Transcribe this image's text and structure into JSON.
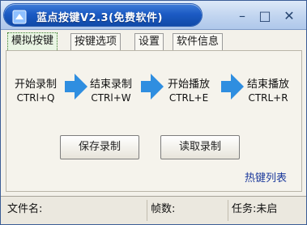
{
  "window": {
    "title": "蓝点按键V2.3(免费软件)",
    "minimize_glyph": "–",
    "maximize_glyph": "□",
    "close_glyph": "✕",
    "title_color": "#1c5bc4"
  },
  "tabs": [
    {
      "label": "模拟按键",
      "active": true
    },
    {
      "label": "按键选项",
      "active": false
    },
    {
      "label": "设置",
      "active": false
    },
    {
      "label": "软件信息",
      "active": false
    }
  ],
  "steps": [
    {
      "label": "开始录制",
      "hotkey": "CTRl+Q"
    },
    {
      "label": "结束录制",
      "hotkey": "CTRl+W"
    },
    {
      "label": "开始播放",
      "hotkey": "CTRL+E"
    },
    {
      "label": "结束播放",
      "hotkey": "CTRL+R"
    }
  ],
  "arrow_icon": "right-arrow-icon",
  "arrow_color": "#2f8ee0",
  "buttons": {
    "save": "保存录制",
    "load": "读取录制"
  },
  "hotkey_list_link": "热键列表",
  "status": {
    "filename": "文件名:",
    "frames": "帧数:",
    "task": "任务:未启"
  }
}
